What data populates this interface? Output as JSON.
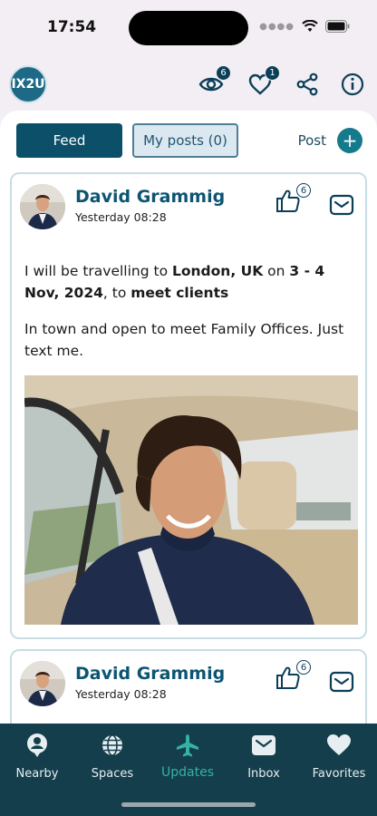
{
  "status_bar": {
    "time": "17:54"
  },
  "header": {
    "logo_text": "IX2U",
    "views_badge": "6",
    "likes_badge": "1"
  },
  "tabs": {
    "feed_label": "Feed",
    "my_posts_label": "My posts (0)",
    "post_label": "Post",
    "plus_symbol": "+"
  },
  "posts": [
    {
      "author": "David Grammig",
      "timestamp": "Yesterday 08:28",
      "like_count": "6",
      "text_1_a": "I will be travelling to ",
      "text_1_b": "London, UK",
      "text_1_c": " on ",
      "text_1_d": "3 - 4 Nov, 2024",
      "text_1_e": ", to ",
      "text_1_f": "meet clients",
      "text_2": "In town and open to meet Family Offices. Just text me."
    },
    {
      "author": "David Grammig",
      "timestamp": "Yesterday 08:28",
      "like_count": "6"
    }
  ],
  "bottom_nav": [
    {
      "label": "Nearby",
      "icon": "person-pin-icon"
    },
    {
      "label": "Spaces",
      "icon": "globe-icon"
    },
    {
      "label": "Updates",
      "icon": "airplane-icon"
    },
    {
      "label": "Inbox",
      "icon": "envelope-icon"
    },
    {
      "label": "Favorites",
      "icon": "heart-icon"
    }
  ],
  "colors": {
    "primary": "#0b4f68",
    "accent": "#34b3a4",
    "nav_bg": "#143e4c",
    "author": "#0c5572"
  }
}
